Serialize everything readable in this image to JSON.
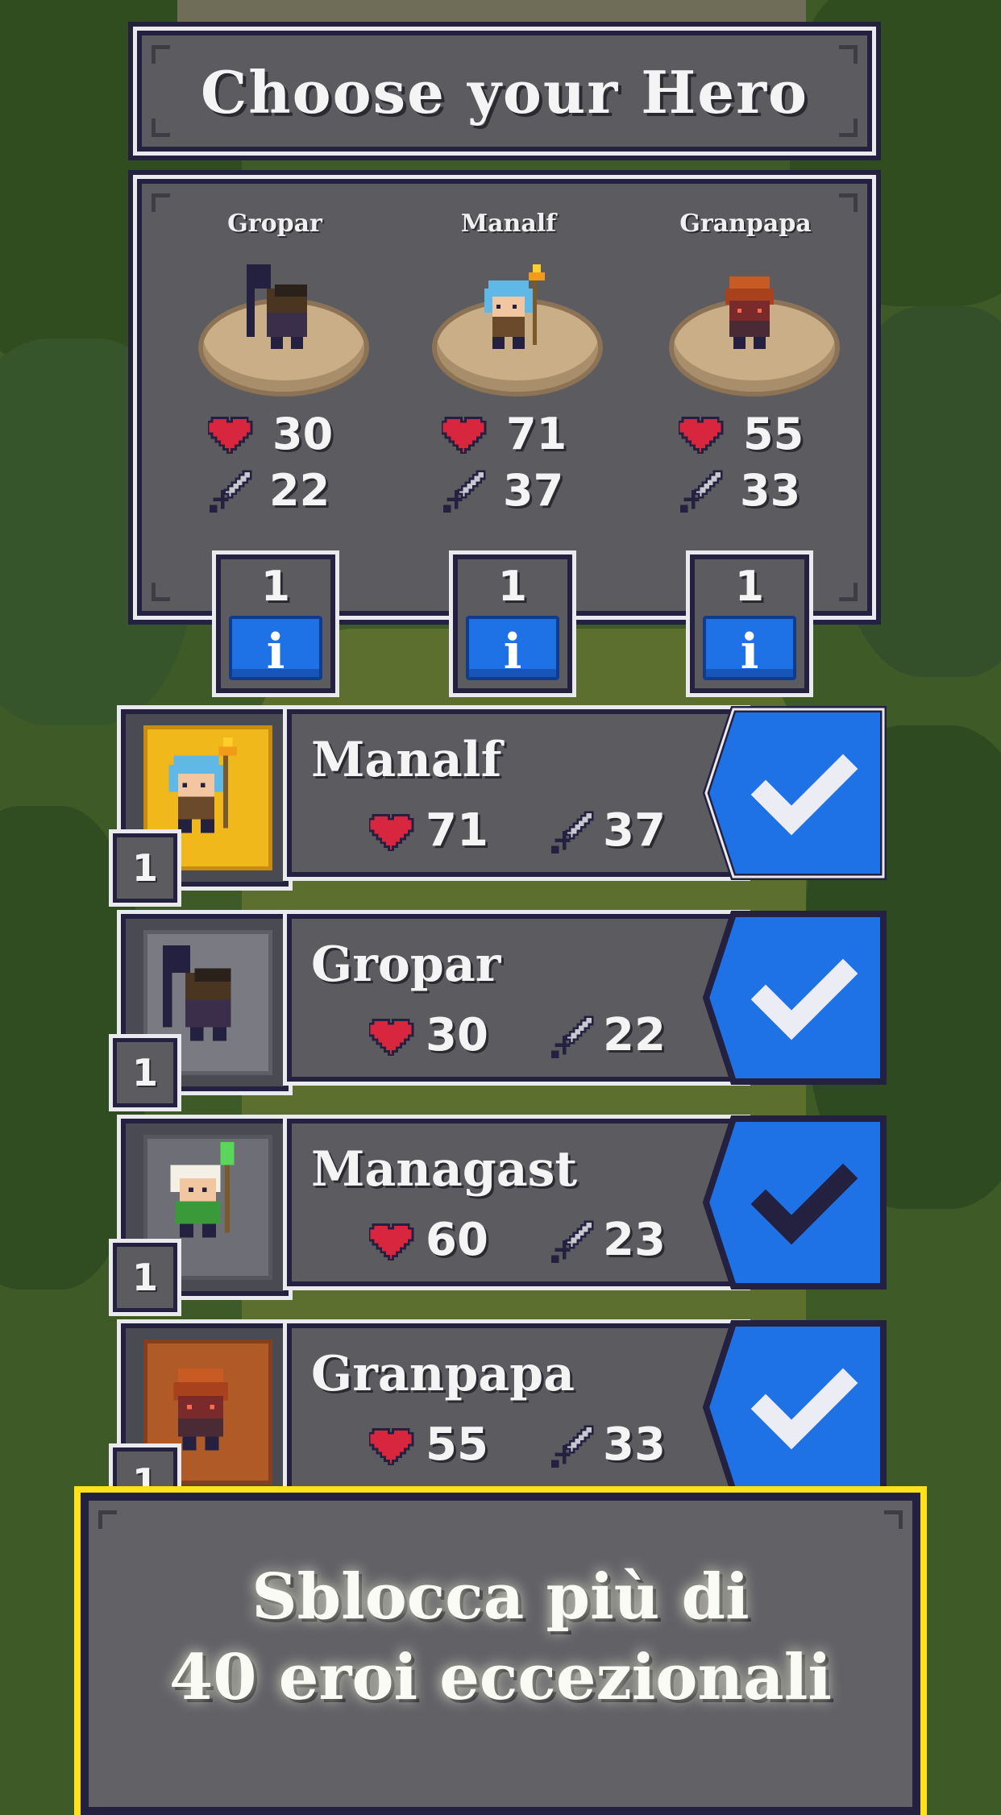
{
  "title": "Choose your Hero",
  "team": [
    {
      "name": "Gropar",
      "hp": "30",
      "attack": "22",
      "level": "1",
      "info_label": "i"
    },
    {
      "name": "Manalf",
      "hp": "71",
      "attack": "37",
      "level": "1",
      "info_label": "i"
    },
    {
      "name": "Granpapa",
      "hp": "55",
      "attack": "33",
      "level": "1",
      "info_label": "i"
    }
  ],
  "heroes": [
    {
      "name": "Manalf",
      "hp": "71",
      "attack": "37",
      "level": "1",
      "card_color": "#f0b81a",
      "selected": true
    },
    {
      "name": "Gropar",
      "hp": "30",
      "attack": "22",
      "level": "1",
      "card_color": "#7a7a82",
      "selected": true
    },
    {
      "name": "Managast",
      "hp": "60",
      "attack": "23",
      "level": "1",
      "card_color": "#6e6e76",
      "selected": false
    },
    {
      "name": "Granpapa",
      "hp": "55",
      "attack": "33",
      "level": "1",
      "card_color": "#b05a28",
      "selected": true
    }
  ],
  "banner": {
    "line1": "Sblocca più di",
    "line2": "40 eroi eccezionali"
  },
  "colors": {
    "accent_blue": "#1f72e6",
    "banner_border": "#ffe21a",
    "heart": "#d7263d"
  }
}
